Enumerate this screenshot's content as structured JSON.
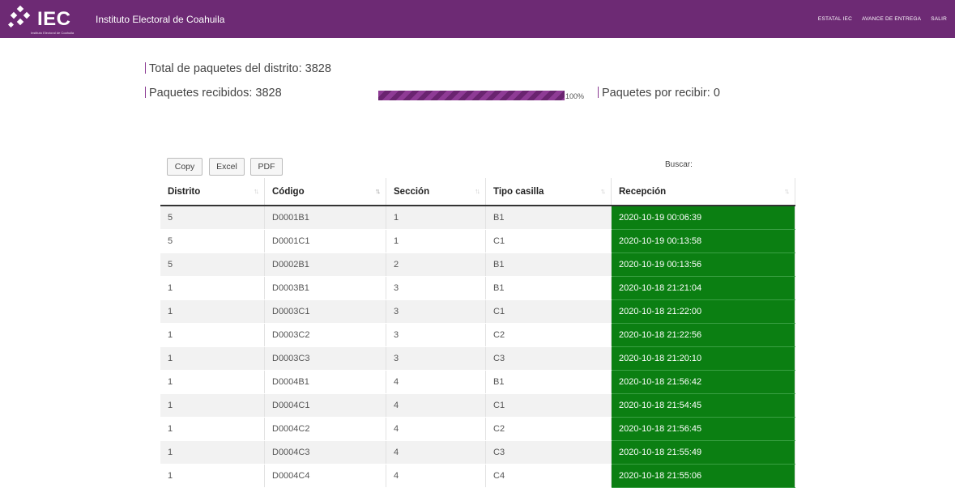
{
  "header": {
    "logo_text": "IEC",
    "logo_subtitle": "Instituto Electoral de Coahuila",
    "title": "Instituto Electoral de Coahuila",
    "nav": [
      "ESTATAL IEC",
      "AVANCE DE ENTREGA",
      "SALIR"
    ]
  },
  "stats": {
    "total": "Total de paquetes del distrito: 3828",
    "received": "Paquetes recibidos: 3828",
    "pending": "Paquetes por recibir: 0",
    "progress_percent": 100,
    "progress_label": "100%"
  },
  "toolbar": {
    "copy": "Copy",
    "excel": "Excel",
    "pdf": "PDF",
    "search_label": "Buscar:"
  },
  "table": {
    "headers": [
      "Distrito",
      "Código",
      "Sección",
      "Tipo casilla",
      "Recepción"
    ],
    "rows": [
      [
        "5",
        "D0001B1",
        "1",
        "B1",
        "2020-10-19 00:06:39"
      ],
      [
        "5",
        "D0001C1",
        "1",
        "C1",
        "2020-10-19 00:13:58"
      ],
      [
        "5",
        "D0002B1",
        "2",
        "B1",
        "2020-10-19 00:13:56"
      ],
      [
        "1",
        "D0003B1",
        "3",
        "B1",
        "2020-10-18 21:21:04"
      ],
      [
        "1",
        "D0003C1",
        "3",
        "C1",
        "2020-10-18 21:22:00"
      ],
      [
        "1",
        "D0003C2",
        "3",
        "C2",
        "2020-10-18 21:22:56"
      ],
      [
        "1",
        "D0003C3",
        "3",
        "C3",
        "2020-10-18 21:20:10"
      ],
      [
        "1",
        "D0004B1",
        "4",
        "B1",
        "2020-10-18 21:56:42"
      ],
      [
        "1",
        "D0004C1",
        "4",
        "C1",
        "2020-10-18 21:54:45"
      ],
      [
        "1",
        "D0004C2",
        "4",
        "C2",
        "2020-10-18 21:56:45"
      ],
      [
        "1",
        "D0004C3",
        "4",
        "C3",
        "2020-10-18 21:55:49"
      ],
      [
        "1",
        "D0004C4",
        "4",
        "C4",
        "2020-10-18 21:55:06"
      ]
    ]
  },
  "colors": {
    "header_bg": "#6d2a74",
    "received_green": "#0b7f12",
    "progress_purple": "#8e3b95"
  }
}
